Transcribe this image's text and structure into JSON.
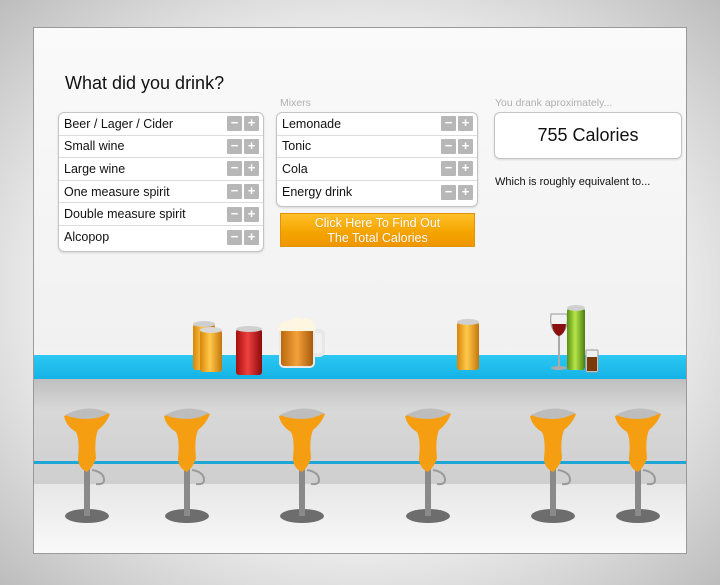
{
  "heading": "What did you drink?",
  "drinks": [
    {
      "label": "Beer / Lager / Cider"
    },
    {
      "label": "Small wine"
    },
    {
      "label": "Large wine"
    },
    {
      "label": "One measure spirit"
    },
    {
      "label": "Double measure spirit"
    },
    {
      "label": "Alcopop"
    }
  ],
  "mixers_label": "Mixers",
  "mixers": [
    {
      "label": "Lemonade"
    },
    {
      "label": "Tonic"
    },
    {
      "label": "Cola"
    },
    {
      "label": "Energy drink"
    }
  ],
  "controls": {
    "minus": "−",
    "plus": "+"
  },
  "cta": {
    "line1": "Click Here To Find Out",
    "line2": "The Total Calories"
  },
  "result": {
    "label": "You drank aproximately...",
    "calories": "755 Calories",
    "equivalent": "Which is roughly equivalent to..."
  },
  "colors": {
    "bar_top": "#18b7e8",
    "accent_orange": "#f5a500",
    "stool_seat": "#f59e12",
    "stool_metal": "#6d6d6d"
  }
}
